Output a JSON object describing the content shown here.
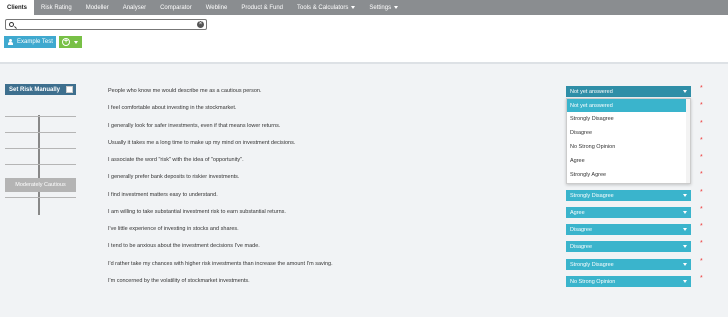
{
  "nav": {
    "items": [
      {
        "label": "Clients",
        "active": true,
        "caret": false
      },
      {
        "label": "Risk Rating",
        "active": false,
        "caret": false
      },
      {
        "label": "Modeller",
        "active": false,
        "caret": false
      },
      {
        "label": "Analyser",
        "active": false,
        "caret": false
      },
      {
        "label": "Comparator",
        "active": false,
        "caret": false
      },
      {
        "label": "Webline",
        "active": false,
        "caret": false
      },
      {
        "label": "Product & Fund",
        "active": false,
        "caret": false
      },
      {
        "label": "Tools & Calculators",
        "active": false,
        "caret": true
      },
      {
        "label": "Settings",
        "active": false,
        "caret": true
      }
    ]
  },
  "search": {
    "value": "",
    "placeholder": ""
  },
  "client": {
    "name": "Example Test"
  },
  "risk_panel": {
    "set_manual_label": "Set Risk Manually",
    "profile_label": "Moderately Cautious"
  },
  "questions": [
    {
      "text": "People who know me would describe me as a cautious person.",
      "answer": "Not yet answered"
    },
    {
      "text": "I feel comfortable about investing in the stockmarket.",
      "answer": ""
    },
    {
      "text": "I generally look for safer investments, even if that means lower returns.",
      "answer": ""
    },
    {
      "text": "Usually it takes me a long time to make up my mind on investment decisions.",
      "answer": ""
    },
    {
      "text": "I associate the word \"risk\" with the idea of \"opportunity\".",
      "answer": ""
    },
    {
      "text": "I generally prefer bank deposits to riskier investments.",
      "answer": ""
    },
    {
      "text": "I find investment matters easy to understand.",
      "answer": "Strongly Disagree"
    },
    {
      "text": "I am willing to take substantial investment risk to earn substantial returns.",
      "answer": "Agree"
    },
    {
      "text": "I've little experience of investing in stocks and shares.",
      "answer": "Disagree"
    },
    {
      "text": "I tend to be anxious about the investment decisions I've made.",
      "answer": "Disagree"
    },
    {
      "text": "I'd rather take my chances with higher risk investments than increase the amount I'm saving.",
      "answer": "Strongly Disagree"
    },
    {
      "text": "I'm concerned by the volatility of stockmarket investments.",
      "answer": "No Strong Opinion"
    }
  ],
  "dropdown": {
    "options": [
      "Not yet answered",
      "Strongly Disagree",
      "Disagree",
      "No Strong Opinion",
      "Agree",
      "Strongly Agree"
    ],
    "selected_index": 0
  },
  "required_marker": "*",
  "colors": {
    "nav_bg": "#8a8d90",
    "accent": "#3ab4cc",
    "client_button": "#3fa9cf",
    "add_button": "#78c046",
    "set_risk_bg": "#3e6f8e",
    "required": "#ee3333"
  }
}
